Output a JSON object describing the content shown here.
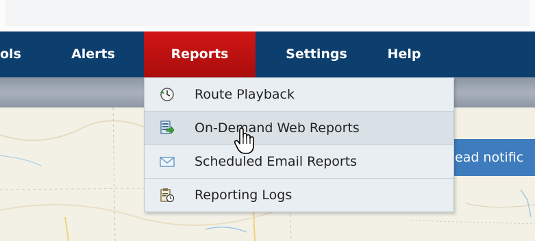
{
  "nav": {
    "items": [
      {
        "label": "ols"
      },
      {
        "label": "Alerts"
      },
      {
        "label": "Reports"
      },
      {
        "label": "Settings"
      },
      {
        "label": "Help"
      }
    ],
    "active_index": 2
  },
  "reports_menu": {
    "items": [
      {
        "label": "Route Playback",
        "icon": "clock-replay-icon"
      },
      {
        "label": "On-Demand Web Reports",
        "icon": "report-export-icon"
      },
      {
        "label": "Scheduled Email Reports",
        "icon": "envelope-icon"
      },
      {
        "label": "Reporting Logs",
        "icon": "clipboard-clock-icon"
      }
    ],
    "hovered_index": 1
  },
  "banner": {
    "text": "ead notific"
  },
  "colors": {
    "nav_bg": "#0c3f6d",
    "active_tab": "#c31212",
    "banner": "#3e7cbd",
    "menu_bg": "#e9eef2"
  }
}
